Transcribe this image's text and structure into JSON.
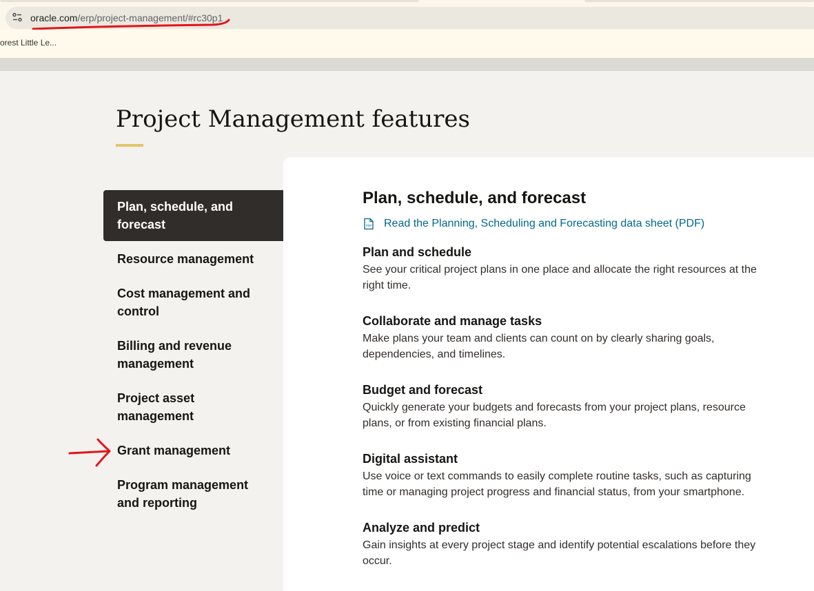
{
  "browser": {
    "url_domain": "oracle.com",
    "url_path": "/erp/project-management/#rc30p1",
    "bookmark": "orest Little Le..."
  },
  "page": {
    "title": "Project Management features"
  },
  "sidebar": {
    "items": [
      {
        "label": "Plan, schedule, and forecast",
        "active": true
      },
      {
        "label": "Resource management"
      },
      {
        "label": "Cost management and control"
      },
      {
        "label": "Billing and revenue management"
      },
      {
        "label": "Project asset management"
      },
      {
        "label": "Grant management"
      },
      {
        "label": "Program management and reporting"
      }
    ]
  },
  "content": {
    "heading": "Plan, schedule, and forecast",
    "datasheet_link": "Read the Planning, Scheduling and Forecasting data sheet (PDF)",
    "features": [
      {
        "title": "Plan and schedule",
        "body": "See your critical project plans in one place and allocate the right resources at the right time."
      },
      {
        "title": "Collaborate and manage tasks",
        "body": "Make plans your team and clients can count on by clearly sharing goals, dependencies, and timelines."
      },
      {
        "title": "Budget and forecast",
        "body": "Quickly generate your budgets and forecasts from your project plans, resource plans, or from existing financial plans."
      },
      {
        "title": "Digital assistant",
        "body": "Use voice or text commands to easily complete routine tasks, such as capturing time or managing project progress and financial status, from your smartphone."
      },
      {
        "title": "Analyze and predict",
        "body": "Gain insights at every project stage and identify potential escalations before they occur."
      }
    ]
  },
  "colors": {
    "active_bg": "#312d2a",
    "link": "#00688c",
    "accent": "#e5c46b",
    "annotation": "#e3141b"
  },
  "icons": [
    "site-info-icon",
    "pdf-icon",
    "red-arrow-annotation",
    "red-underline-annotation"
  ]
}
